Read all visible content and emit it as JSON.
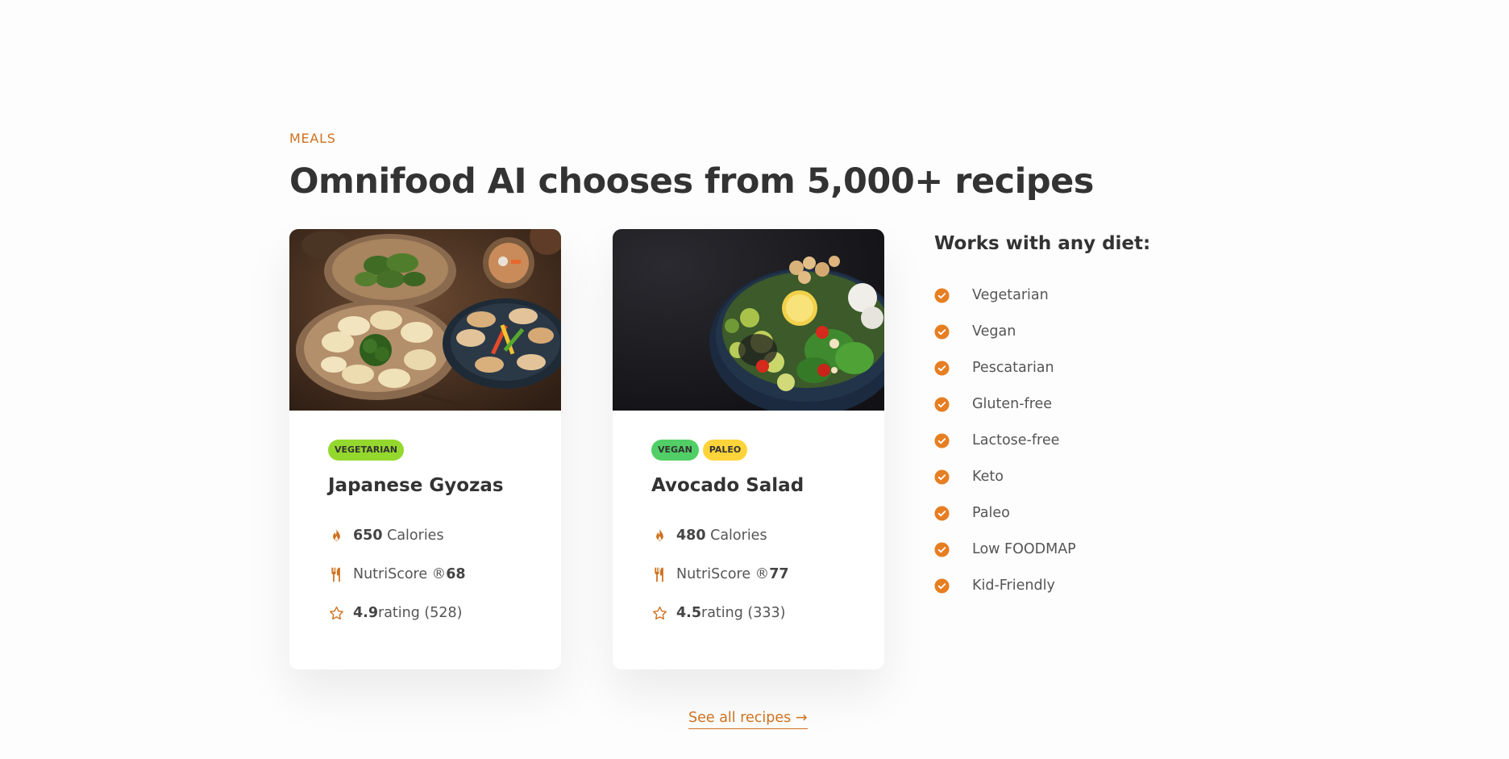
{
  "section": {
    "subheading": "Meals",
    "heading": "Omnifood AI chooses from 5,000+ recipes",
    "accent_color": "#cf711f"
  },
  "meals": [
    {
      "tags": [
        "Vegetarian"
      ],
      "title": "Japanese Gyozas",
      "calories_value": "650",
      "calories_label": "Calories",
      "nutri_label": "NutriScore ®",
      "nutri_value": "68",
      "rating_value": "4.9",
      "rating_label": "rating (528)",
      "image_alt": "Japanese Gyozas"
    },
    {
      "tags": [
        "Vegan",
        "Paleo"
      ],
      "title": "Avocado Salad",
      "calories_value": "480",
      "calories_label": "Calories",
      "nutri_label": "NutriScore ®",
      "nutri_value": "77",
      "rating_value": "4.5",
      "rating_label": "rating (333)",
      "image_alt": "Avocado Salad"
    }
  ],
  "diets": {
    "heading": "Works with any diet:",
    "items": [
      "Vegetarian",
      "Vegan",
      "Pescatarian",
      "Gluten-free",
      "Lactose-free",
      "Keto",
      "Paleo",
      "Low FOODMAP",
      "Kid-Friendly"
    ]
  },
  "cta": {
    "label": "See all recipes →"
  },
  "icons": {
    "calories": "flame-icon",
    "nutri": "restaurant-icon",
    "rating": "star-outline-icon",
    "diet_check": "checkmark-circle-icon"
  },
  "tag_colors": {
    "vegetarian": "#94d82d",
    "vegan": "#51cf66",
    "paleo": "#ffd43b"
  }
}
